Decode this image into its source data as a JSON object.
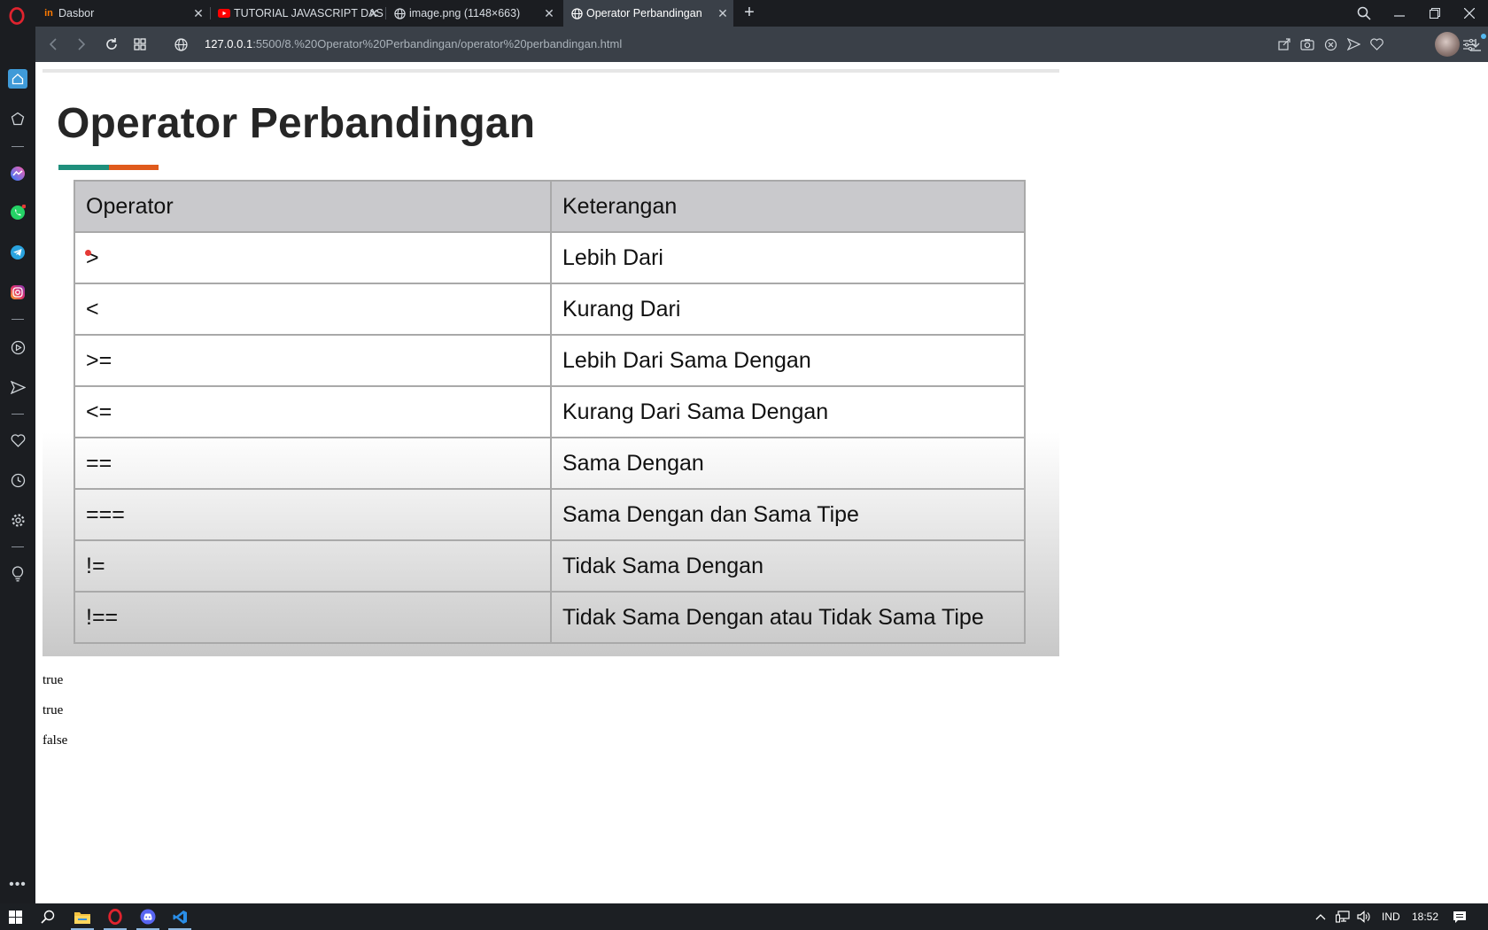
{
  "browser": {
    "tabs": [
      {
        "label": "Dasbor",
        "favicon": "in-logo"
      },
      {
        "label": "TUTORIAL JAVASCRIPT DAS",
        "favicon": "youtube-logo"
      },
      {
        "label": "image.png (1148×663)",
        "favicon": "globe-icon"
      },
      {
        "label": "Operator Perbandingan",
        "favicon": "globe-icon"
      }
    ],
    "active_tab": 3,
    "url_host": "127.0.0.1",
    "url_rest": ":5500/8.%20Operator%20Perbandingan/operator%20perbandingan.html"
  },
  "page": {
    "image_title": "Operator Perbandingan",
    "table": {
      "headers": [
        "Operator",
        "Keterangan"
      ],
      "rows": [
        [
          ">",
          "Lebih Dari"
        ],
        [
          "<",
          "Kurang Dari"
        ],
        [
          ">=",
          "Lebih Dari Sama Dengan"
        ],
        [
          "<=",
          "Kurang Dari Sama Dengan"
        ],
        [
          "==",
          "Sama Dengan"
        ],
        [
          "===",
          "Sama Dengan dan Sama Tipe"
        ],
        [
          "!=",
          "Tidak Sama Dengan"
        ],
        [
          "!==",
          "Tidak Sama Dengan atau Tidak Sama Tipe"
        ]
      ]
    },
    "output_lines": [
      "true",
      "true",
      "false"
    ]
  },
  "taskbar": {
    "language": "IND",
    "clock": "18:52"
  },
  "colors": {
    "accent_teal": "#1f8f7c",
    "accent_orange": "#e05a1c",
    "chrome_dark": "#1b1d21",
    "chrome_bar": "#3a4048"
  }
}
